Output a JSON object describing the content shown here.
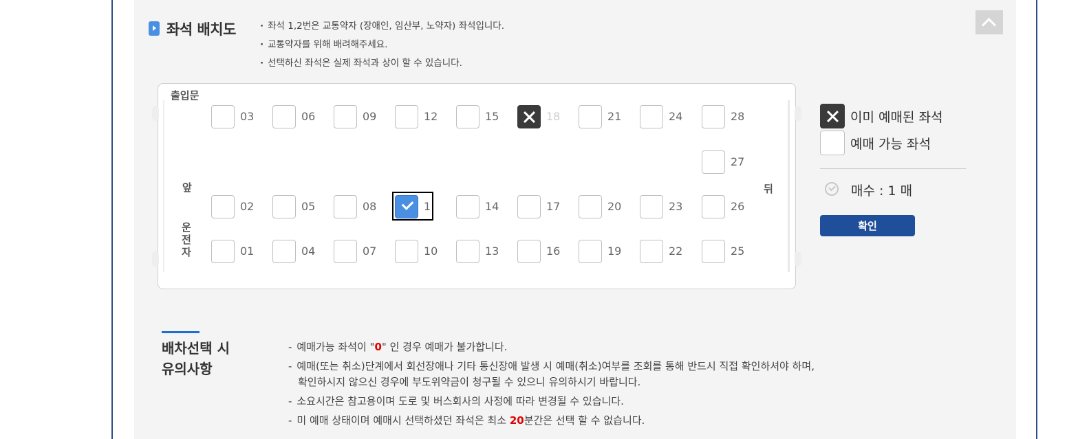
{
  "section": {
    "title": "좌석 배치도",
    "notes": [
      "좌석 1,2번은 교통약자 (장애인, 임산부, 노약자) 좌석입니다.",
      "교통약자를 위해 배려해주세요.",
      "선택하신 좌석은 실제 좌석과 상이 할 수 있습니다."
    ]
  },
  "bus": {
    "entrance_label": "출입문",
    "front_label": "앞",
    "back_label": "뒤",
    "driver_label": "운전자",
    "rows": [
      [
        {
          "num": "03",
          "status": "available"
        },
        {
          "num": "06",
          "status": "available"
        },
        {
          "num": "09",
          "status": "available"
        },
        {
          "num": "12",
          "status": "available"
        },
        {
          "num": "15",
          "status": "available"
        },
        {
          "num": "18",
          "status": "sold"
        },
        {
          "num": "21",
          "status": "available"
        },
        {
          "num": "24",
          "status": "available"
        },
        {
          "num": "28",
          "status": "available"
        }
      ],
      [
        {
          "num": "27",
          "status": "available"
        }
      ],
      [
        {
          "num": "02",
          "status": "available"
        },
        {
          "num": "05",
          "status": "available"
        },
        {
          "num": "08",
          "status": "available"
        },
        {
          "num": "1",
          "status": "selected"
        },
        {
          "num": "14",
          "status": "available"
        },
        {
          "num": "17",
          "status": "available"
        },
        {
          "num": "20",
          "status": "available"
        },
        {
          "num": "23",
          "status": "available"
        },
        {
          "num": "26",
          "status": "available"
        }
      ],
      [
        {
          "num": "01",
          "status": "available"
        },
        {
          "num": "04",
          "status": "available"
        },
        {
          "num": "07",
          "status": "available"
        },
        {
          "num": "10",
          "status": "available"
        },
        {
          "num": "13",
          "status": "available"
        },
        {
          "num": "16",
          "status": "available"
        },
        {
          "num": "19",
          "status": "available"
        },
        {
          "num": "22",
          "status": "available"
        },
        {
          "num": "25",
          "status": "available"
        }
      ]
    ]
  },
  "legend": {
    "sold_label": "이미 예매된 좌석",
    "available_label": "예매 가능 좌석",
    "count_label": "매수 : 1 매",
    "confirm_label": "확인"
  },
  "caution": {
    "title_line1": "배차선택 시",
    "title_line2": "유의사항",
    "items": [
      {
        "before": "예매가능 좌석이 \"",
        "highlight": "0",
        "after": "\" 인 경우 예매가 불가합니다.",
        "cont": ""
      },
      {
        "before": "예매(또는 취소)단계에서 회선장애나 기타 통신장애 발생 시 예매(취소)여부를 조회를 통해 반드시 직접 확인하셔야 하며,",
        "highlight": "",
        "after": "",
        "cont": "확인하시지 않으신 경우에 부도위약금이 청구될 수 있으니 유의하시기 바랍니다."
      },
      {
        "before": "소요시간은 참고용이며 도로 및 버스회사의 사정에 따라 변경될 수 있습니다.",
        "highlight": "",
        "after": "",
        "cont": ""
      },
      {
        "before": "미 예매 상태이며 예매시 선택하셨던 좌석은 최소 ",
        "highlight": "20",
        "after": "분간은 선택 할 수 없습니다.",
        "cont": ""
      }
    ]
  },
  "colors": {
    "accent": "#4a90e2",
    "confirm": "#1f4e9a",
    "sold": "#3a3a3a",
    "highlight": "#e00000"
  },
  "icons": {
    "top_button": "chevron-up-icon",
    "title_marker": "play-arrow-icon",
    "count": "check-circle-icon"
  }
}
